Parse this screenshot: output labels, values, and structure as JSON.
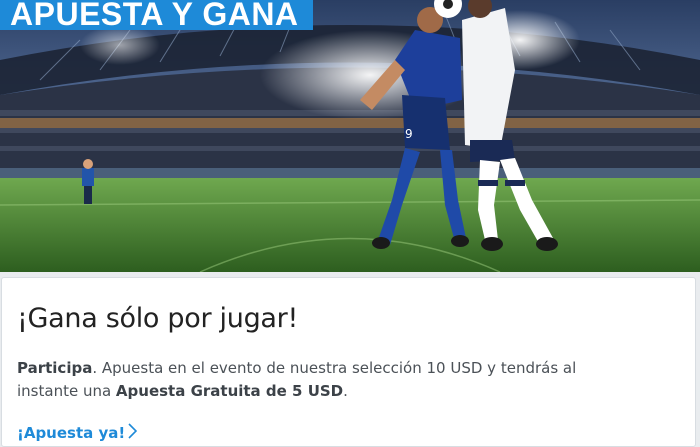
{
  "banner": {
    "title": "APUESTA Y GANA"
  },
  "promo": {
    "heading": "¡Gana sólo por jugar!",
    "intro_bold": "Participa",
    "intro_text": ". Apuesta en el evento de nuestra selección 10 USD y tendrás al instante una ",
    "bonus_bold": "Apuesta Gratuita de 5 USD",
    "end_text": ".",
    "cta_label": "¡Apuesta ya!",
    "cta_icon": "chevron-right-icon"
  },
  "hero_image": {
    "jersey_number": "9"
  },
  "colors": {
    "accent": "#1e8ad8",
    "pitch": "#3d7a2c",
    "card_bg": "#ffffff"
  }
}
